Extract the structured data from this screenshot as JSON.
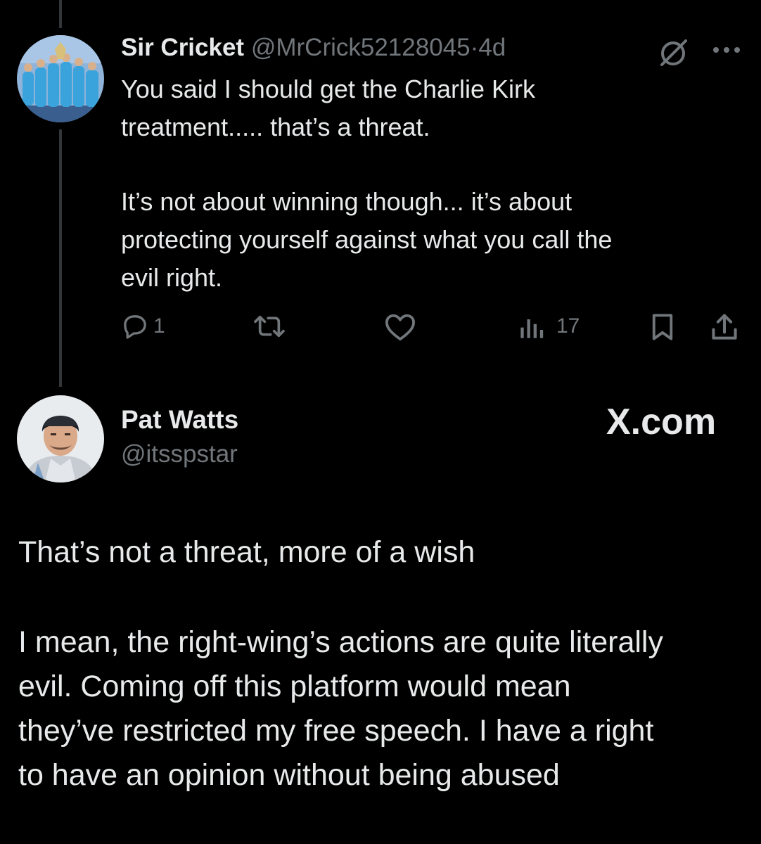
{
  "reply_tweet": {
    "author_name": "Sir Cricket",
    "handle": "@MrCrick52128045",
    "separator": "·",
    "time": "4d",
    "more_label": "···",
    "paragraphs": [
      "You said I should get the Charlie Kirk\ntreatment..... that’s a threat.",
      "It’s not about winning though... it’s about\nprotecting yourself against what you call the\nevil right."
    ],
    "actions": {
      "reply_count": "1",
      "views_count": "17"
    }
  },
  "main_tweet": {
    "author_name": "Pat Watts",
    "handle": "@itsspstar",
    "watermark": "X.com",
    "paragraphs": [
      "That’s not a threat, more of a wish",
      "I mean, the right-wing’s actions are quite literally\nevil. Coming off this platform would mean\nthey’ve restricted my free speech. I have a right\nto have an opinion without being abused"
    ]
  },
  "icons": [
    "grok-icon",
    "more-icon",
    "reply-icon",
    "retweet-icon",
    "like-icon",
    "views-icon",
    "bookmark-icon",
    "share-icon"
  ],
  "colors": {
    "background": "#000000",
    "text": "#e7e9ea",
    "muted": "#71767b",
    "thread_line": "#333639"
  }
}
